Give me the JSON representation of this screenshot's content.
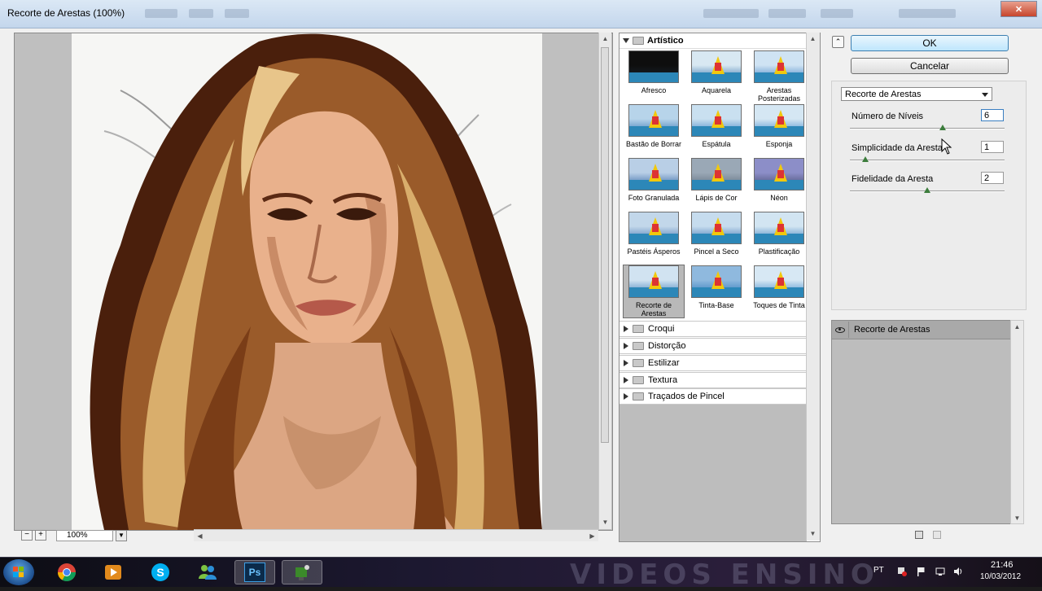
{
  "window": {
    "title": "Recorte de Arestas (100%)"
  },
  "preview": {
    "zoom": "100%",
    "zoom_minus": "−",
    "zoom_plus": "+"
  },
  "gallery": {
    "open_category": "Artístico",
    "thumbnails": [
      {
        "label": "Afresco"
      },
      {
        "label": "Aquarela"
      },
      {
        "label": "Arestas Posterizadas"
      },
      {
        "label": "Bastão de Borrar"
      },
      {
        "label": "Espátula"
      },
      {
        "label": "Esponja"
      },
      {
        "label": "Foto Granulada"
      },
      {
        "label": "Lápis de Cor"
      },
      {
        "label": "Néon"
      },
      {
        "label": "Pastéis Ásperos"
      },
      {
        "label": "Pincel a Seco"
      },
      {
        "label": "Plastificação"
      },
      {
        "label": "Recorte de Arestas"
      },
      {
        "label": "Tinta-Base"
      },
      {
        "label": "Toques de Tinta"
      }
    ],
    "selected_index": 12,
    "categories": [
      "Croqui",
      "Distorção",
      "Estilizar",
      "Textura",
      "Traçados de Pincel"
    ]
  },
  "settings": {
    "ok_label": "OK",
    "cancel_label": "Cancelar",
    "filter_selected": "Recorte de Arestas",
    "params": [
      {
        "label": "Número de Níveis",
        "value": "6",
        "level": 0.6
      },
      {
        "label": "Simplicidade da Aresta",
        "value": "1",
        "level": 0.1
      },
      {
        "label": "Fidelidade da Aresta",
        "value": "2",
        "level": 0.5
      }
    ]
  },
  "layers": {
    "items": [
      {
        "label": "Recorte de Arestas"
      }
    ]
  },
  "taskbar": {
    "language": "PT",
    "time": "21:46",
    "date": "10/03/2012",
    "apps": [
      "chrome-icon",
      "media-player-icon",
      "skype-icon",
      "messenger-icon",
      "photoshop-icon",
      "camtasia-icon"
    ],
    "photoshop_label": "Ps"
  },
  "colors": {
    "accent_ok": "#bee6fd",
    "slider_knob": "#3c7d3c",
    "hair_dark": "#4a1f0c",
    "hair_mid": "#9a5b2a",
    "hair_light": "#d9ae6c",
    "skin": "#e9b18c"
  }
}
